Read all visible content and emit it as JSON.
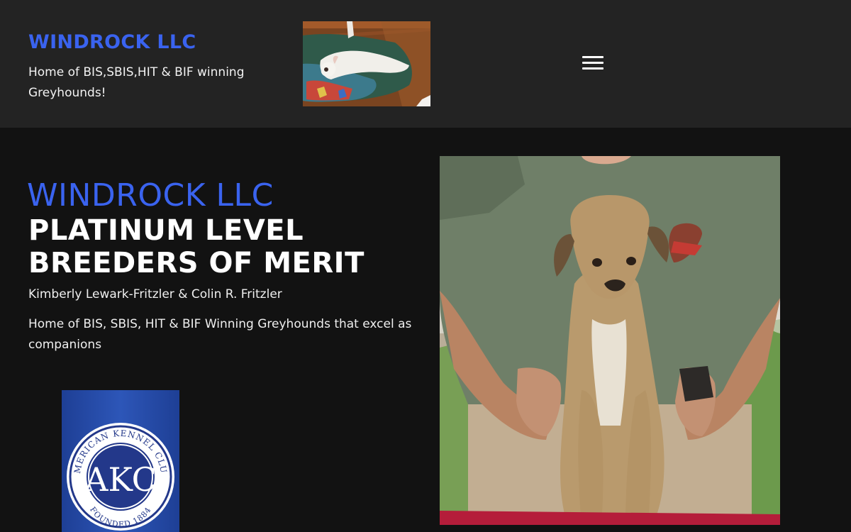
{
  "header": {
    "brand": "WINDROCK LLC",
    "tagline": "Home of BIS,SBIS,HIT & BIF winning Greyhounds!",
    "photo_icon": "dog-on-blanket-photo",
    "menu_icon": "hamburger-menu-icon"
  },
  "hero": {
    "title_light": "WINDROCK LLC",
    "title_bold": "PLATINUM LEVEL BREEDERS OF MERIT",
    "owners": "Kimberly Lewark-Fritzler & Colin R. Fritzler",
    "description": "Home of BIS, SBIS, HIT & BIF Winning Greyhounds that excel as companions",
    "photo_icon": "puppy-photo"
  },
  "akc_logo": {
    "ring_text": "AMERICAN KENNEL CLUB",
    "monogram": "AKC",
    "founded": "FOUNDED 1884"
  },
  "colors": {
    "accent": "#3a63ef",
    "header_bg": "#232323",
    "page_bg": "#121212"
  }
}
